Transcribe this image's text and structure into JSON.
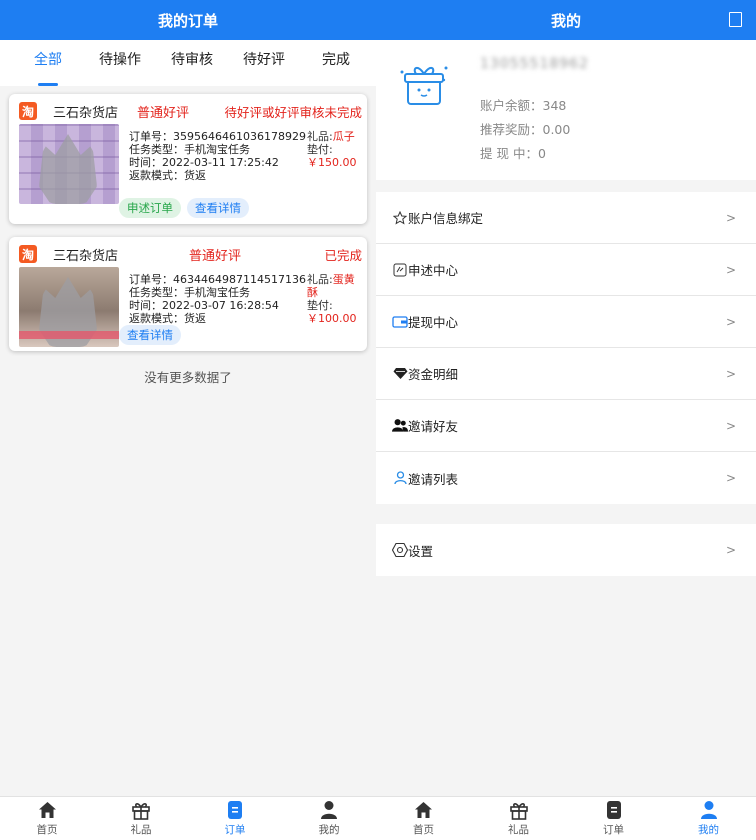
{
  "left": {
    "title": "我的订单",
    "tabs": [
      "全部",
      "待操作",
      "待审核",
      "待好评",
      "完成"
    ],
    "orders": [
      {
        "platform_icon": "淘",
        "shop": "三石杂货店",
        "type": "普通好评",
        "status": "待好评或好评审核未完成",
        "order_no": "订单号：3595646461036178929",
        "task_type": "任务类型：手机淘宝任务",
        "time": "时间：2022-03-11 17:25:42",
        "refund": "返款模式：货返",
        "gift_label": "礼品:",
        "gift_name": "瓜子",
        "advance_label": "垫付:",
        "amount": "￥150.00",
        "buttons": [
          "申述订单",
          "查看详情"
        ]
      },
      {
        "platform_icon": "淘",
        "shop": "三石杂货店",
        "type": "普通好评",
        "status": "已完成",
        "order_no": "订单号：4634464987114517136",
        "task_type": "任务类型：手机淘宝任务",
        "time": "时间：2022-03-07 16:28:54",
        "refund": "返款模式：货返",
        "gift_label": "礼品:",
        "gift_name": "蛋黄酥",
        "advance_label": "垫付:",
        "amount": "￥100.00",
        "buttons": [
          "查看详情"
        ]
      }
    ],
    "no_more": "没有更多数据了"
  },
  "right": {
    "title": "我的",
    "phone": "13055518962",
    "balance": "账户余额：348",
    "reward": "推荐奖励：0.00",
    "withdrawing": "提 现 中：0",
    "menu": [
      {
        "label": "账户信息绑定",
        "icon": "star-outline-icon"
      },
      {
        "label": "申述中心",
        "icon": "complaint-icon"
      },
      {
        "label": "提现中心",
        "icon": "wallet-icon"
      },
      {
        "label": "资金明细",
        "icon": "diamond-icon"
      },
      {
        "label": "邀请好友",
        "icon": "users-icon"
      },
      {
        "label": "邀请列表",
        "icon": "user-icon"
      }
    ],
    "settings": "设置",
    "arrow": ">"
  },
  "nav": [
    {
      "label": "首页",
      "icon": "home-icon"
    },
    {
      "label": "礼品",
      "icon": "gift-icon"
    },
    {
      "label": "订单",
      "icon": "order-icon"
    },
    {
      "label": "我的",
      "icon": "profile-icon"
    }
  ],
  "colors": {
    "accent": "#1e7ef2",
    "red": "#e3241d",
    "taobao": "#f45a22",
    "green": "#27a64a"
  }
}
